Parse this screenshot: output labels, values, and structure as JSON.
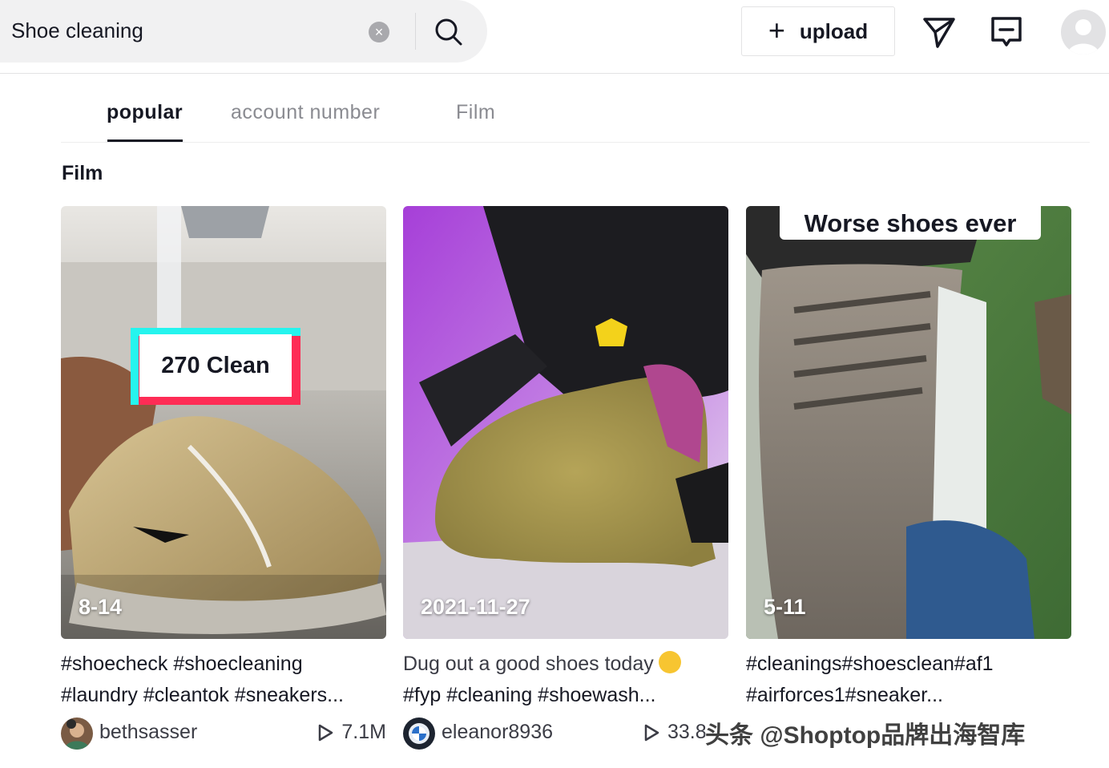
{
  "search": {
    "value": "Shoe cleaning",
    "clear_icon": "x-circle-icon",
    "search_icon": "search-icon"
  },
  "header": {
    "upload_label": "upload",
    "upload_icon": "plus-icon",
    "inbox_icon": "send-icon",
    "messages_icon": "message-icon",
    "avatar_icon": "user-avatar-icon"
  },
  "tabs": [
    {
      "label": "popular",
      "active": true
    },
    {
      "label": "account number",
      "active": false
    },
    {
      "label": "Film",
      "active": false
    }
  ],
  "section_title": "Film",
  "cards": [
    {
      "overlay_text": "270 Clean",
      "date": "8-14",
      "desc_line1": "#shoecheck #shoecleaning",
      "desc_line2": "#laundry #cleantok #sneakers...",
      "username": "bethsasser",
      "plays": "7.1M"
    },
    {
      "overlay_text": "",
      "date": "2021-11-27",
      "desc_line1": "Dug out a good shoes today",
      "desc_line2": "#fyp #cleaning #shoewash...",
      "username": "eleanor8936",
      "plays": "33.8"
    },
    {
      "overlay_text": "Worse shoes ever",
      "date": "5-11",
      "desc_line1": "#cleanings#shoesclean#af1",
      "desc_line2": "#airforces1#sneaker...",
      "username": "",
      "plays": ""
    }
  ],
  "watermark": "头条 @Shoptop品牌出海智库",
  "colors": {
    "accent_red": "#fe2c55",
    "accent_cyan": "#25f4ee",
    "text": "#161823",
    "muted": "#8a8b91"
  }
}
